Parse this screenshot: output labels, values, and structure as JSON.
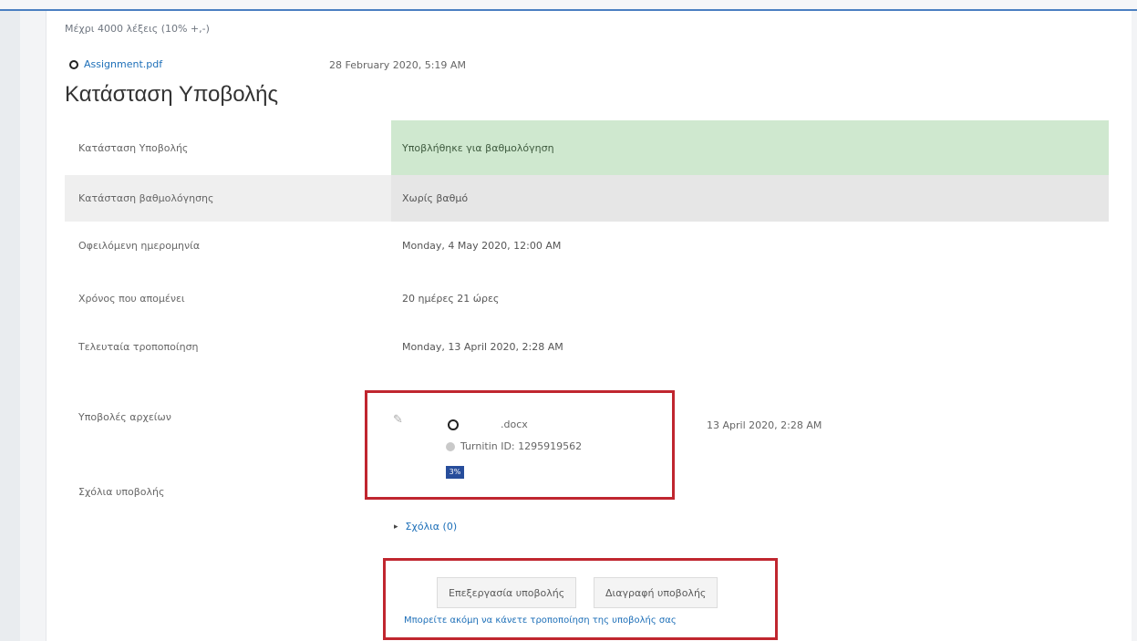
{
  "page": {
    "word_limit": "Μέχρι 4000 λέξεις (10% +,-)",
    "attachment": {
      "name": "Assignment.pdf",
      "date": "28 February 2020, 5:19 AM",
      "icon": "file-icon"
    },
    "heading": "Κατάσταση Υποβολής"
  },
  "status_table": {
    "rows": [
      {
        "label": "Κατάσταση Υποβολής",
        "value": "Υποβλήθηκε για βαθμολόγηση"
      },
      {
        "label": "Κατάσταση βαθμολόγησης",
        "value": "Χωρίς βαθμό"
      },
      {
        "label": "Οφειλόμενη ημερομηνία",
        "value": "Monday, 4 May 2020, 12:00 AM"
      },
      {
        "label": "Χρόνος που απομένει",
        "value": "20 ημέρες 21 ώρες"
      },
      {
        "label": "Τελευταία τροποποίηση",
        "value": "Monday, 13 April 2020, 2:28 AM"
      },
      {
        "label": "Υποβολές αρχείων",
        "value": ""
      },
      {
        "label": "Σχόλια υποβολής",
        "value": ""
      }
    ]
  },
  "file_submission": {
    "file_name": ".docx",
    "turnitin": "Turnitin ID: 1295919562",
    "percent": "3%",
    "date": "13 April 2020, 2:28 AM"
  },
  "comments": {
    "link": "Σχόλια (0)"
  },
  "actions": {
    "edit": "Επεξεργασία υποβολής",
    "remove": "Διαγραφή υποβολής",
    "note": "Μπορείτε ακόμη να κάνετε τροποποίηση της υποβολής σας"
  },
  "colors": {
    "accent": "#4a7fc1",
    "submitted": "#cfe8cf",
    "highlight": "#c0262f",
    "badge": "#274d9b"
  }
}
